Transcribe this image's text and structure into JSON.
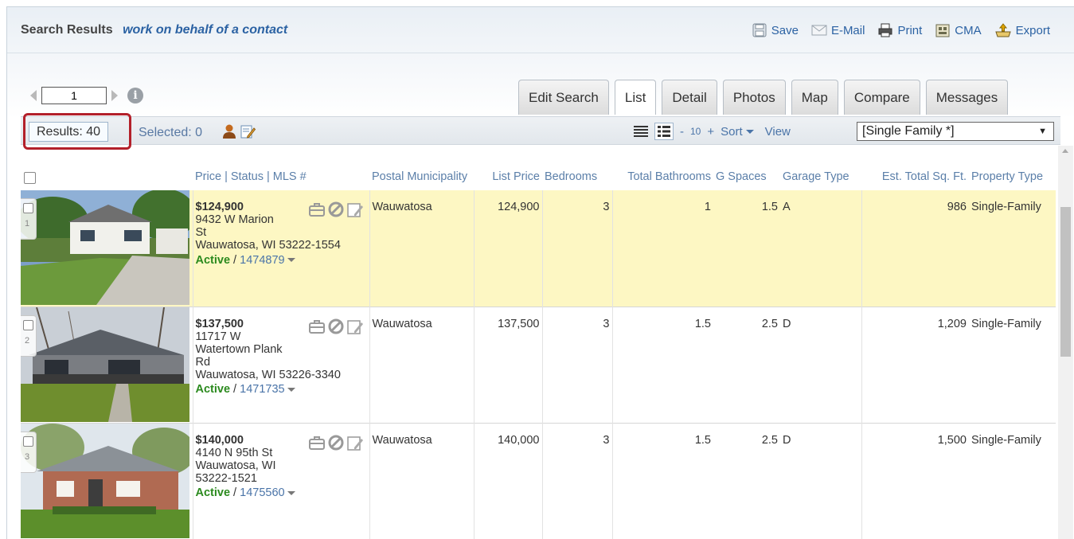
{
  "header": {
    "title": "Search Results",
    "subtitle": "work on behalf of a contact",
    "actions": [
      "Save",
      "E-Mail",
      "Print",
      "CMA",
      "Export"
    ]
  },
  "pager": {
    "page": "1"
  },
  "tabs": [
    "Edit Search",
    "List",
    "Detail",
    "Photos",
    "Map",
    "Compare",
    "Messages"
  ],
  "toolbar": {
    "results": "Results: 40",
    "selected": "Selected: 0",
    "per_page_minus": "-",
    "per_page": "10",
    "per_page_plus": "+",
    "sort": "Sort",
    "view": "View",
    "view_select": "[Single Family *]"
  },
  "columns": {
    "price_status": "Price | Status | MLS #",
    "postal_municipality": "Postal Municipality",
    "list_price": "List Price",
    "bedrooms": "Bedrooms",
    "total_bathrooms": "Total Bathrooms",
    "g_spaces": "G Spaces",
    "garage_type": "Garage Type",
    "est_total_sqft": "Est. Total Sq. Ft.",
    "property_type": "Property Type"
  },
  "listings": [
    {
      "num": "1",
      "price": "$124,900",
      "address": [
        "9432 W Marion",
        "St",
        "Wauwatosa, WI 53222-1554"
      ],
      "status": "Active",
      "mls": "1474879",
      "municipality": "Wauwatosa",
      "list_price": "124,900",
      "bedrooms": "3",
      "bathrooms": "1",
      "g_spaces": "1.5",
      "garage_type": "A",
      "sqft": "986",
      "property_type": "Single-Family"
    },
    {
      "num": "2",
      "price": "$137,500",
      "address": [
        "11717 W",
        "Watertown Plank",
        "Rd",
        "Wauwatosa, WI 53226-3340"
      ],
      "status": "Active",
      "mls": "1471735",
      "municipality": "Wauwatosa",
      "list_price": "137,500",
      "bedrooms": "3",
      "bathrooms": "1.5",
      "g_spaces": "2.5",
      "garage_type": "D",
      "sqft": "1,209",
      "property_type": "Single-Family"
    },
    {
      "num": "3",
      "price": "$140,000",
      "address": [
        "4140 N 95th St",
        "Wauwatosa, WI",
        "53222-1521"
      ],
      "status": "Active",
      "mls": "1475560",
      "municipality": "Wauwatosa",
      "list_price": "140,000",
      "bedrooms": "3",
      "bathrooms": "1.5",
      "g_spaces": "2.5",
      "garage_type": "D",
      "sqft": "1,500",
      "property_type": "Single-Family"
    }
  ]
}
